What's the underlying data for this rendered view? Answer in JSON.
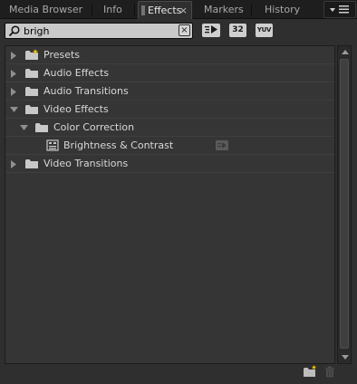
{
  "tabs": [
    {
      "label": "Media Browser"
    },
    {
      "label": "Info"
    },
    {
      "label": "Effects",
      "active": true
    },
    {
      "label": "Markers"
    },
    {
      "label": "History"
    }
  ],
  "tab_close_glyph": "×",
  "search": {
    "value": "brigh",
    "clear_glyph": "×"
  },
  "toolbar": {
    "accelerated_icon": "accelerated-effects-icon",
    "bit32_label": "32",
    "yuv_label": "YUV"
  },
  "tree": [
    {
      "label": "Presets",
      "icon": "presets-folder-icon",
      "expanded": false,
      "level": 0
    },
    {
      "label": "Audio Effects",
      "icon": "folder-icon",
      "expanded": false,
      "level": 0
    },
    {
      "label": "Audio Transitions",
      "icon": "folder-icon",
      "expanded": false,
      "level": 0
    },
    {
      "label": "Video Effects",
      "icon": "folder-icon",
      "expanded": true,
      "level": 0
    },
    {
      "label": "Color Correction",
      "icon": "folder-icon",
      "expanded": true,
      "level": 1
    },
    {
      "label": "Brightness & Contrast",
      "icon": "effect-icon",
      "level": 2,
      "badge": "accelerated-badge-icon"
    },
    {
      "label": "Video Transitions",
      "icon": "folder-icon",
      "expanded": false,
      "level": 0
    }
  ],
  "colors": {
    "panel_bg": "#2f2f2f",
    "list_bg": "#353535",
    "text": "#d8d8d8",
    "preset_star": "#f2c200"
  }
}
